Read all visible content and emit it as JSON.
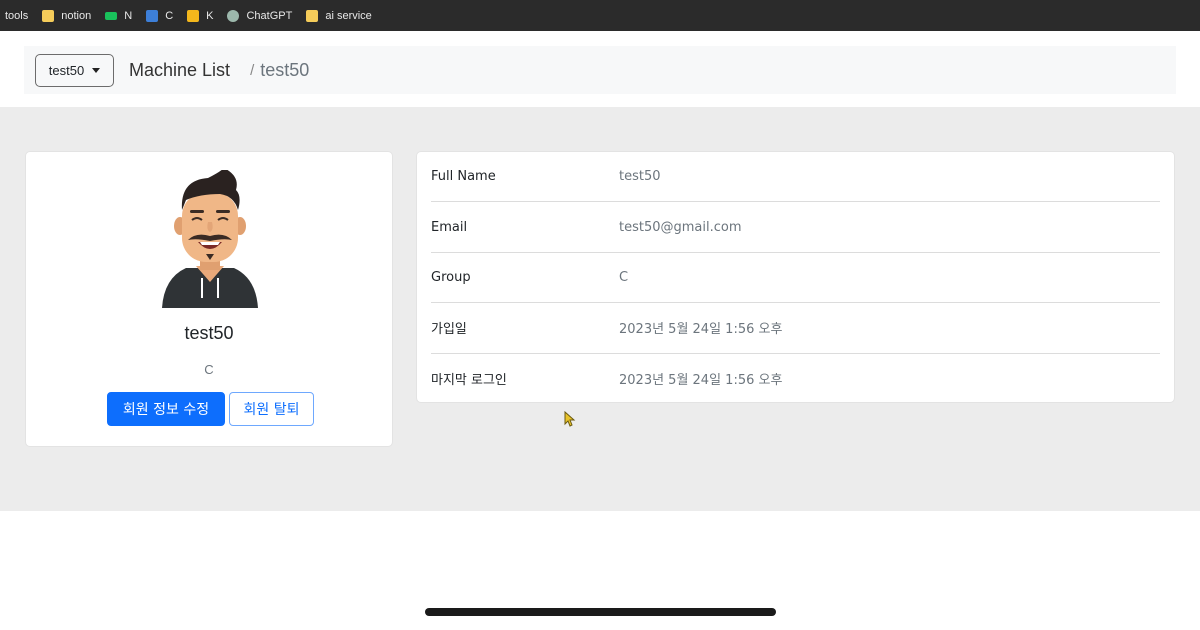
{
  "bookmarks": [
    {
      "label": "tools",
      "icon": "none"
    },
    {
      "label": "notion",
      "icon": "folder-icon"
    },
    {
      "label": "N",
      "icon": "green-site-icon"
    },
    {
      "label": "C",
      "icon": "calendar-icon"
    },
    {
      "label": "K",
      "icon": "yellow-site-icon"
    },
    {
      "label": "ChatGPT",
      "icon": "chatgpt-icon"
    },
    {
      "label": "ai service",
      "icon": "folder-icon"
    }
  ],
  "header": {
    "dropdown_value": "test50",
    "breadcrumb_root": "Machine List",
    "breadcrumb_separator": "/",
    "breadcrumb_current": "test50"
  },
  "profile": {
    "name": "test50",
    "group": "C",
    "edit_button": "회원 정보 수정",
    "leave_button": "회원 탈퇴"
  },
  "info": {
    "rows": [
      {
        "label": "Full Name",
        "value": "test50"
      },
      {
        "label": "Email",
        "value": "test50@gmail.com"
      },
      {
        "label": "Group",
        "value": "C"
      },
      {
        "label": "가입일",
        "value": "2023년 5월 24일 1:56 오후"
      },
      {
        "label": "마지막 로그인",
        "value": "2023년 5월 24일 1:56 오후"
      }
    ]
  },
  "colors": {
    "primary": "#0d6efd",
    "bookmarks_bar": "#2b2b2b",
    "content_bg": "#ececec"
  }
}
